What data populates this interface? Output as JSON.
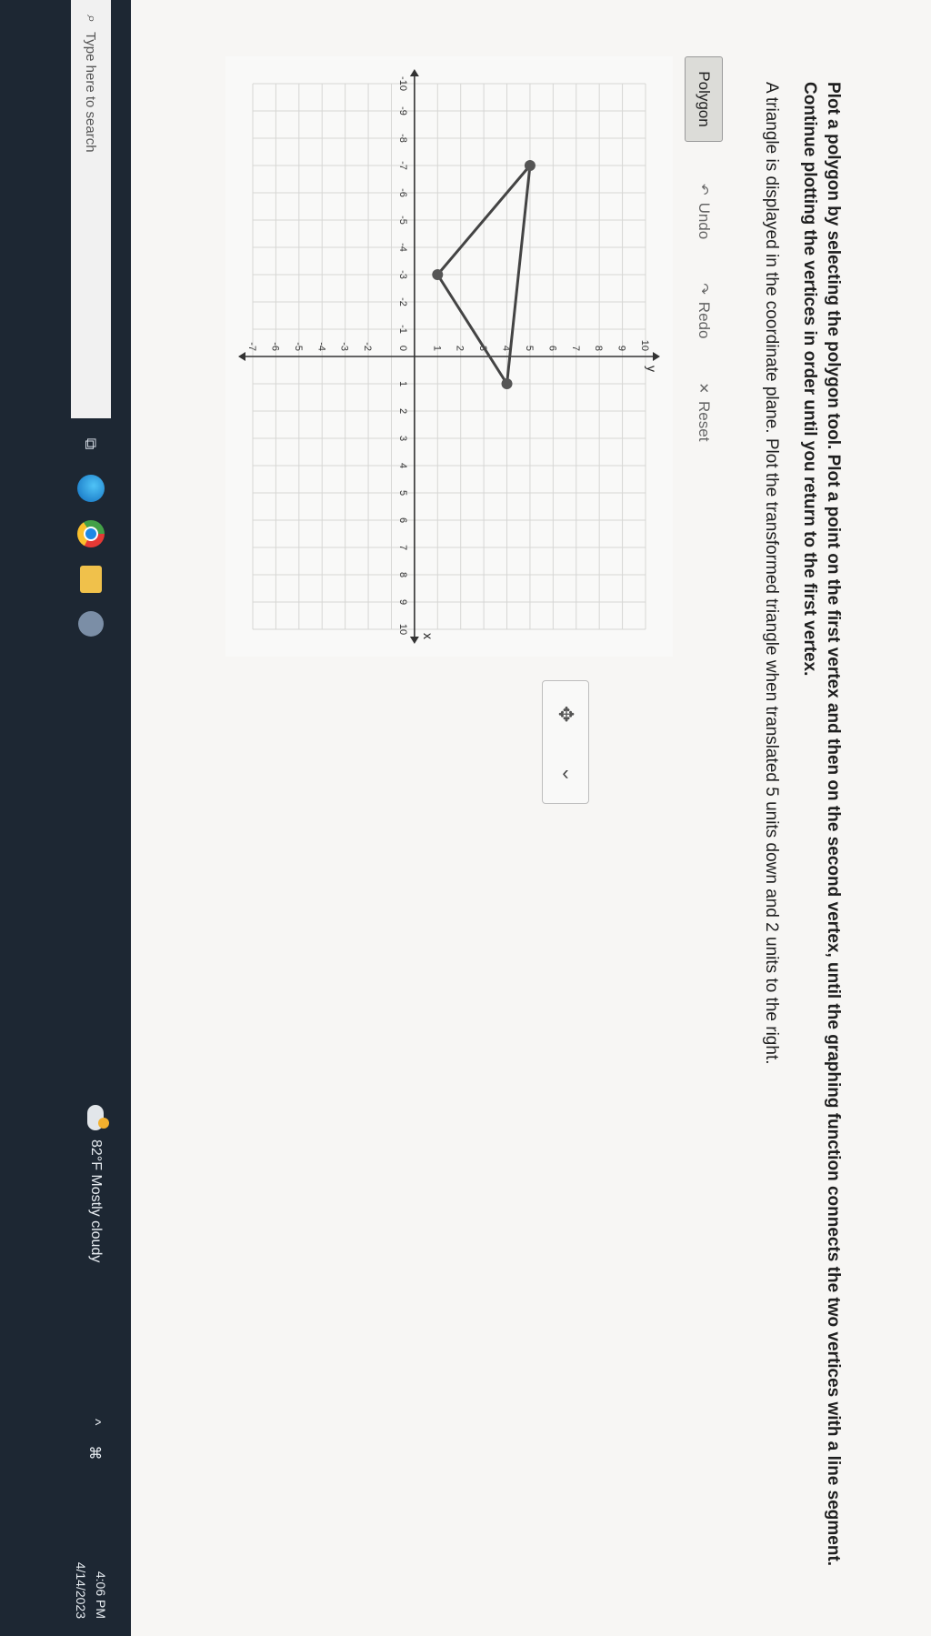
{
  "instructions": {
    "main": "Plot a polygon by selecting the polygon tool. Plot a point on the first vertex and then on the second vertex, until the graphing function connects the two vertices with a line segment. Continue plotting the vertices in order until you return to the first vertex.",
    "task": "A triangle is displayed in the coordinate plane. Plot the transformed triangle when translated 5 units down and 2 units to the right."
  },
  "toolbar": {
    "polygon_label": "Polygon",
    "undo_label": "Undo",
    "redo_label": "Redo",
    "reset_label": "Reset"
  },
  "graph": {
    "x_axis_label": "x",
    "y_axis_label": "y",
    "xlim": [
      -10,
      10
    ],
    "ylim": [
      -7,
      10
    ],
    "x_ticks": [
      -10,
      -9,
      -8,
      -7,
      -6,
      -5,
      -4,
      -3,
      -2,
      -1,
      1,
      2,
      3,
      4,
      5,
      6,
      7,
      8,
      9,
      10
    ],
    "y_ticks": [
      -7,
      -6,
      -5,
      -4,
      -3,
      -2,
      1,
      2,
      3,
      4,
      5,
      6,
      7,
      8,
      9,
      10
    ],
    "origin_label": "0",
    "grid": true,
    "triangle": [
      {
        "x": -7,
        "y": 5
      },
      {
        "x": -3,
        "y": 1
      },
      {
        "x": 1,
        "y": 4
      }
    ],
    "line_color": "#444444",
    "vertex_color": "#555555"
  },
  "taskbar": {
    "search_placeholder": "Type here to search",
    "weather_text": "82°F Mostly cloudy",
    "time": "4:06 PM",
    "date": "4/14/2023"
  }
}
